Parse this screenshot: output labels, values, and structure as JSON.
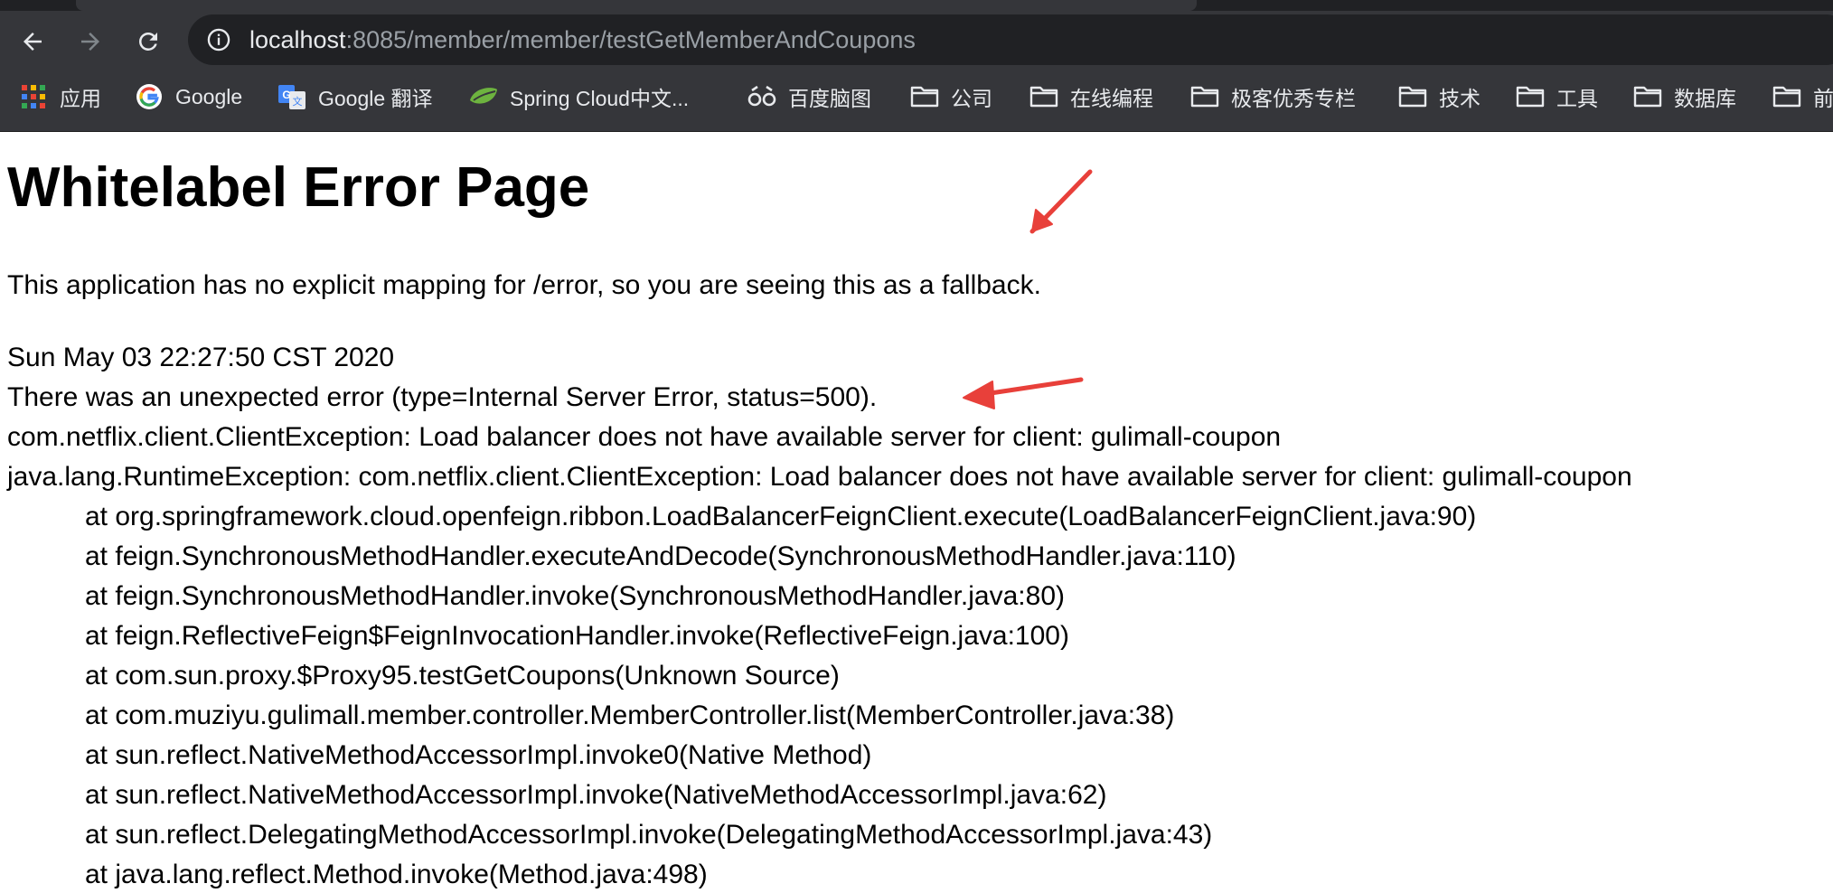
{
  "browser": {
    "url_host": "localhost",
    "url_path": ":8085/member/member/testGetMemberAndCoupons"
  },
  "bookmarks": [
    {
      "label": "应用",
      "icon": "apps-grid-icon"
    },
    {
      "label": "Google",
      "icon": "google-icon"
    },
    {
      "label": "Google 翻译",
      "icon": "google-translate-icon"
    },
    {
      "label": "Spring Cloud中文...",
      "icon": "spring-leaf-icon"
    },
    {
      "label": "百度脑图",
      "icon": "baidu-mindmap-icon"
    },
    {
      "label": "公司",
      "icon": "folder-icon"
    },
    {
      "label": "在线编程",
      "icon": "folder-icon"
    },
    {
      "label": "极客优秀专栏",
      "icon": "folder-icon"
    },
    {
      "label": "技术",
      "icon": "folder-icon"
    },
    {
      "label": "工具",
      "icon": "folder-icon"
    },
    {
      "label": "数据库",
      "icon": "folder-icon"
    },
    {
      "label": "前",
      "icon": "folder-icon"
    }
  ],
  "page": {
    "title": "Whitelabel Error Page",
    "message": "This application has no explicit mapping for /error, so you are seeing this as a fallback.",
    "timestamp": "Sun May 03 22:27:50 CST 2020",
    "error_line": "There was an unexpected error (type=Internal Server Error, status=500).",
    "exception_1": "com.netflix.client.ClientException: Load balancer does not have available server for client: gulimall-coupon",
    "exception_2": "java.lang.RuntimeException: com.netflix.client.ClientException: Load balancer does not have available server for client: gulimall-coupon",
    "stack_trace": [
      "at org.springframework.cloud.openfeign.ribbon.LoadBalancerFeignClient.execute(LoadBalancerFeignClient.java:90)",
      "at feign.SynchronousMethodHandler.executeAndDecode(SynchronousMethodHandler.java:110)",
      "at feign.SynchronousMethodHandler.invoke(SynchronousMethodHandler.java:80)",
      "at feign.ReflectiveFeign$FeignInvocationHandler.invoke(ReflectiveFeign.java:100)",
      "at com.sun.proxy.$Proxy95.testGetCoupons(Unknown Source)",
      "at com.muziyu.gulimall.member.controller.MemberController.list(MemberController.java:38)",
      "at sun.reflect.NativeMethodAccessorImpl.invoke0(Native Method)",
      "at sun.reflect.NativeMethodAccessorImpl.invoke(NativeMethodAccessorImpl.java:62)",
      "at sun.reflect.DelegatingMethodAccessorImpl.invoke(DelegatingMethodAccessorImpl.java:43)",
      "at java.lang.reflect.Method.invoke(Method.java:498)"
    ]
  },
  "annotations": {
    "arrow_color": "#e8403a"
  }
}
